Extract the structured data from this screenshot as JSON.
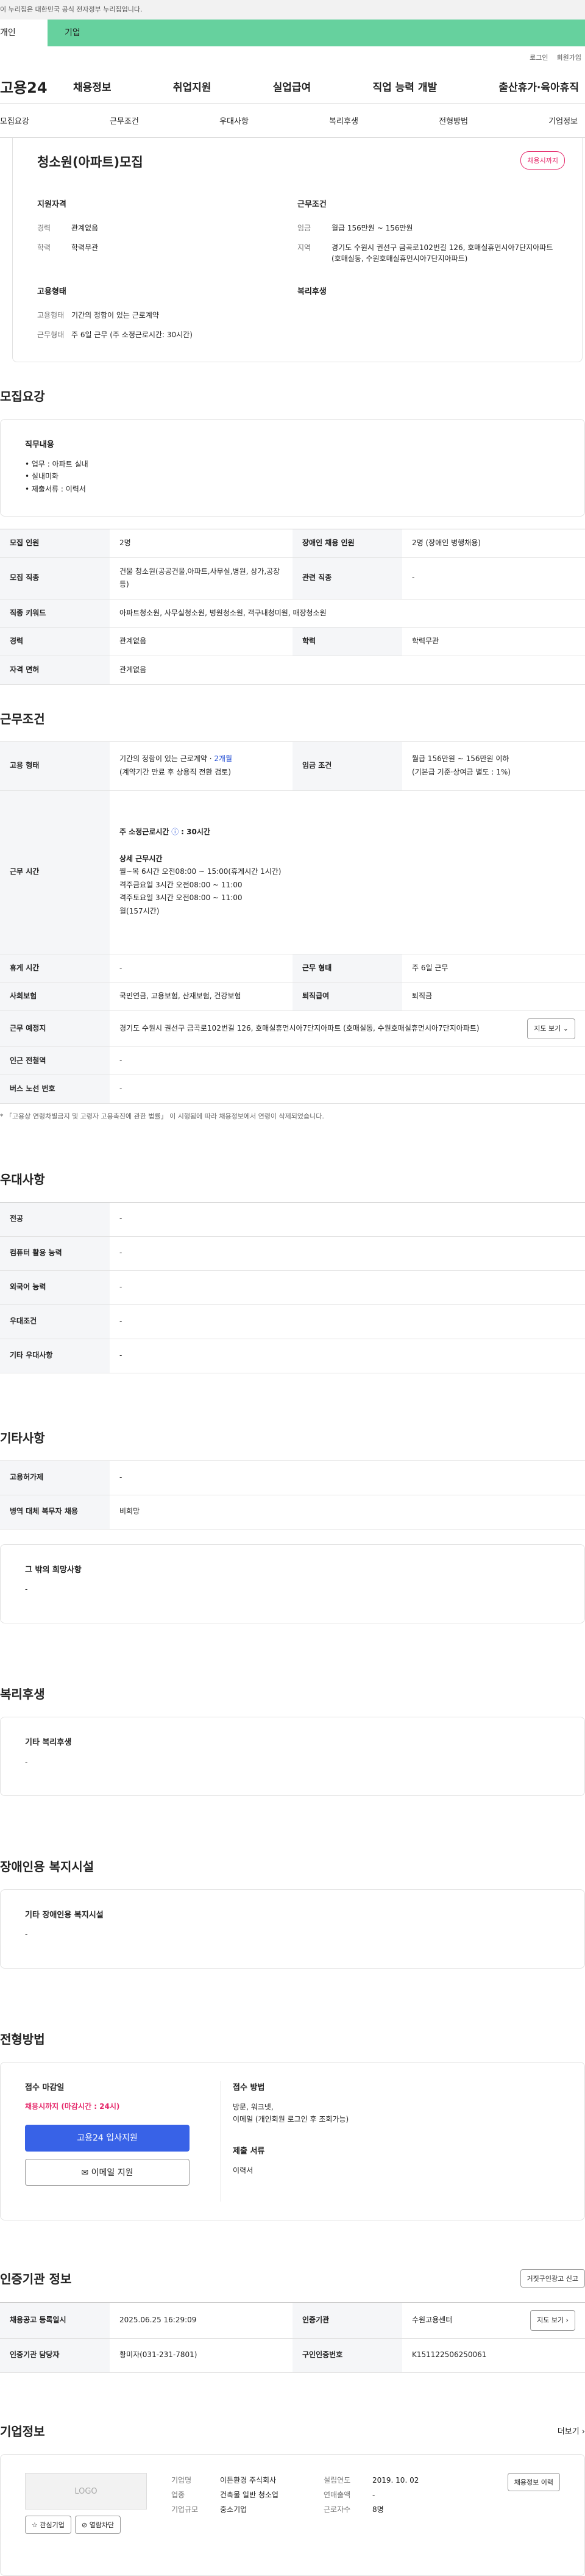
{
  "gov_notice": "이 누리집은 대한민국 공식 전자정부 누리집입니다.",
  "top_strip": {
    "left": "개인",
    "right": "기업"
  },
  "util": {
    "login": "로그인",
    "signup": "회원가입"
  },
  "logo": "고용24",
  "gnb": [
    "채용정보",
    "취업지원",
    "실업급여",
    "직업 능력 개발",
    "출산휴가·육아휴직"
  ],
  "subnav": [
    "모집요강",
    "근무조건",
    "우대사항",
    "복리후생",
    "전형방법",
    "기업정보"
  ],
  "summary": {
    "title": "청소원(아파트)모집",
    "badge": "채용시까지",
    "qual_title": "지원자격",
    "career_k": "경력",
    "career_v": "관계없음",
    "edu_k": "학력",
    "edu_v": "학력무관",
    "work_title": "근무조건",
    "pay_k": "임금",
    "pay_v": "월급 156만원 ~ 156만원",
    "region_k": "지역",
    "region_v": "경기도 수원시 권선구 금곡로102번길 126, 호매실휴먼시아7단지아파트 (호매실동, 수원호매실휴먼시아7단지아파트)",
    "emp_title": "고용형태",
    "emp_k": "고용형태",
    "emp_v": "기간의 정함이 있는 근로계약",
    "hours_k": "근무형태",
    "hours_v": "주 6일 근무 (주 소정근로시간: 30시간)",
    "welfare_title": "복리후생"
  },
  "recruit": {
    "title": "모집요강",
    "duty_label": "직무내용",
    "duties": [
      "• 업무 : 아파트 실내",
      "• 실내미화",
      "• 제출서류 : 이력서"
    ],
    "rows": [
      [
        "모집 인원",
        "2명",
        "장애인 채용 인원",
        "2명 (장애인 병행채용)"
      ],
      [
        "모집 직종",
        "건물 청소원(공공건물,아파트,사무실,병원, 상가,공장 등)",
        "관련 직종",
        "-"
      ],
      [
        "직종 키워드",
        "아파트청소원, 사무실청소원, 병원청소원, 객구내청미원, 매장청소원",
        "",
        ""
      ],
      [
        "경력",
        "관계없음",
        "학력",
        "학력무관"
      ],
      [
        "자격 면허",
        "관계없음",
        "",
        ""
      ]
    ]
  },
  "conditions": {
    "title": "근무조건",
    "emp_k": "고용 형태",
    "emp_v1": "기간의 정함이 있는 근로계약 · ",
    "emp_v1b": "2개월",
    "emp_v2": "(계약기간 만료 후 상용직 전환 검토)",
    "pay_k": "임금 조건",
    "pay_v1": "월급 156만원 ~ 156만원 이하",
    "pay_v2": "(기본급 기준·상여금 별도 : 1%)",
    "time_k": "근무 시간",
    "weekly": "주 소정근로시간",
    "weekly_v": ": 30시간",
    "detail_title": "상세 근무시간",
    "detail": [
      "월~목 6시간      오전08:00 ~ 15:00(휴게시간 1시간)",
      "격주금요일 3시간 오전08:00 ~ 11:00",
      "격주토요일 3시간 오전08:00 ~ 11:00",
      "월(157시간)"
    ],
    "rest_k": "휴게 시간",
    "rest_v": "-",
    "type_k": "근무 형태",
    "type_v": "주 6일 근무",
    "ins_k": "사회보험",
    "ins_v": "국민연금, 고용보험, 산재보험, 건강보험",
    "ret_k": "퇴직급여",
    "ret_v": "퇴직금",
    "place_k": "근무 예정지",
    "place_v": "경기도 수원시 권선구 금곡로102번길 126, 호매실휴먼시아7단지아파트 (호매실동, 수원호매실휴먼시아7단지아파트)",
    "map_btn": "지도 보기 ⌄",
    "subway_k": "인근 전철역",
    "subway_v": "-",
    "bus_k": "버스 노선 번호",
    "bus_v": "-",
    "note": "* 「고용상 연령차별금지 및 고령자 고용촉진에 관한 법률」 이 시행됨에 따라 채용정보에서 연령이 삭제되었습니다."
  },
  "pref": {
    "title": "우대사항",
    "rows": [
      [
        "전공",
        "-"
      ],
      [
        "컴퓨터 활용 능력",
        "-"
      ],
      [
        "외국어 능력",
        "-"
      ],
      [
        "우대조건",
        "-"
      ],
      [
        "기타 우대사항",
        "-"
      ]
    ]
  },
  "etc": {
    "title": "기타사항",
    "rows": [
      [
        "고용허가제",
        "-"
      ],
      [
        "병역 대체 복무자 채용",
        "비희망"
      ]
    ],
    "other_label": "그 밖의 희망사항",
    "other_v": "-"
  },
  "welfare": {
    "title": "복리후생",
    "label": "기타 복리후생",
    "v": "-"
  },
  "disabled": {
    "title": "장애인용 복지시설",
    "label": "기타 장애인용 복지시설",
    "v": "-"
  },
  "screening": {
    "title": "전형방법",
    "deadline_label": "접수 마감일",
    "deadline_v": "채용시까지 (마감시간 : 24시)",
    "apply": "고용24 입사지원",
    "email": "이메일 지원",
    "method_label": "접수 방법",
    "methods": [
      "방문, 워크넷,",
      "이메일 (개인회원 로그인 후 조회가능)"
    ],
    "docs_label": "제출 서류",
    "docs_v": "이력서"
  },
  "cert": {
    "title": "인증기관 정보",
    "report_btn": "거짓구인광고 신고",
    "rows": [
      [
        "채용공고 등록일시",
        "2025.06.25 16:29:09",
        "인증기관",
        "수원고용센터"
      ],
      [
        "인증기관 담당자",
        "황미자(031-231-7801)",
        "구인인증번호",
        "K151122506250061"
      ]
    ],
    "map_btn": "지도 보기 ›"
  },
  "company": {
    "title": "기업정보",
    "more": "더보기 ›",
    "logo": "LOGO",
    "fav": "관심기업",
    "block": "열람차단",
    "name_k": "기업명",
    "name_v": "이든환경 주식회사",
    "ind_k": "업종",
    "ind_v": "건축물 일반 청소업",
    "size_k": "기업규모",
    "size_v": "중소기업",
    "est_k": "설립연도",
    "est_v": "2019. 10. 02",
    "sales_k": "연매출액",
    "sales_v": "-",
    "emp_k": "근로자수",
    "emp_v": "8명",
    "more_jobs": "채용정보 이력"
  }
}
